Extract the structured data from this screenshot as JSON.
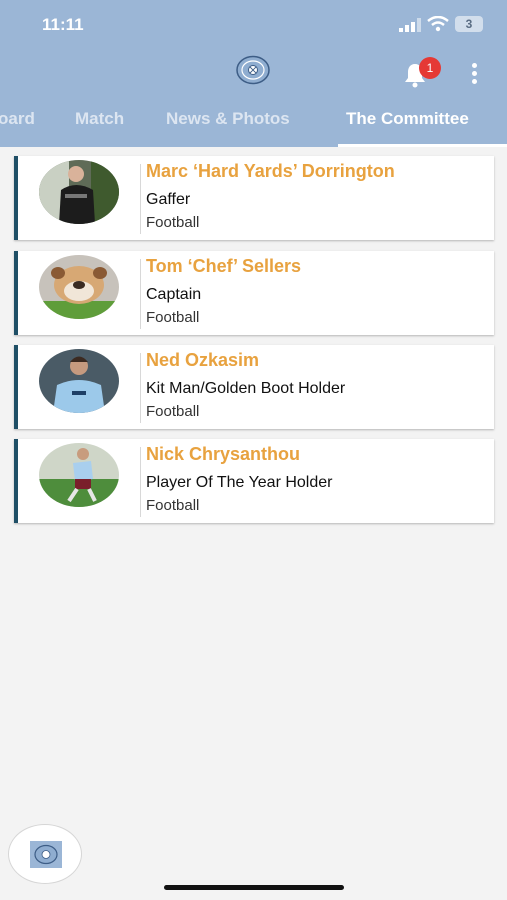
{
  "status_bar": {
    "time": "11:11",
    "battery": "3",
    "signal_icon": "signal-icon",
    "wifi_icon": "wifi-icon"
  },
  "header": {
    "logo_icon": "club-crest-icon",
    "notification_icon": "bell-icon",
    "notification_count": "1",
    "menu_icon": "more-vertical-icon",
    "background_color": "#9bb6d6"
  },
  "tabs": [
    {
      "label": "oard"
    },
    {
      "label": "Match"
    },
    {
      "label": "News & Photos"
    },
    {
      "label": "The Committee",
      "active": true
    }
  ],
  "members": [
    {
      "name": "Marc ‘Hard Yards’ Dorrington",
      "role": "Gaffer",
      "sport": "Football"
    },
    {
      "name": "Tom ‘Chef’ Sellers",
      "role": "Captain",
      "sport": "Football"
    },
    {
      "name": "Ned Ozkasim",
      "role": "Kit Man/Golden Boot Holder",
      "sport": "Football"
    },
    {
      "name": "Nick Chrysanthou",
      "role": "Player Of The Year Holder",
      "sport": "Football"
    }
  ],
  "colors": {
    "accent": "#e8a23f",
    "card_border": "#1f4f66",
    "badge": "#e53935"
  }
}
